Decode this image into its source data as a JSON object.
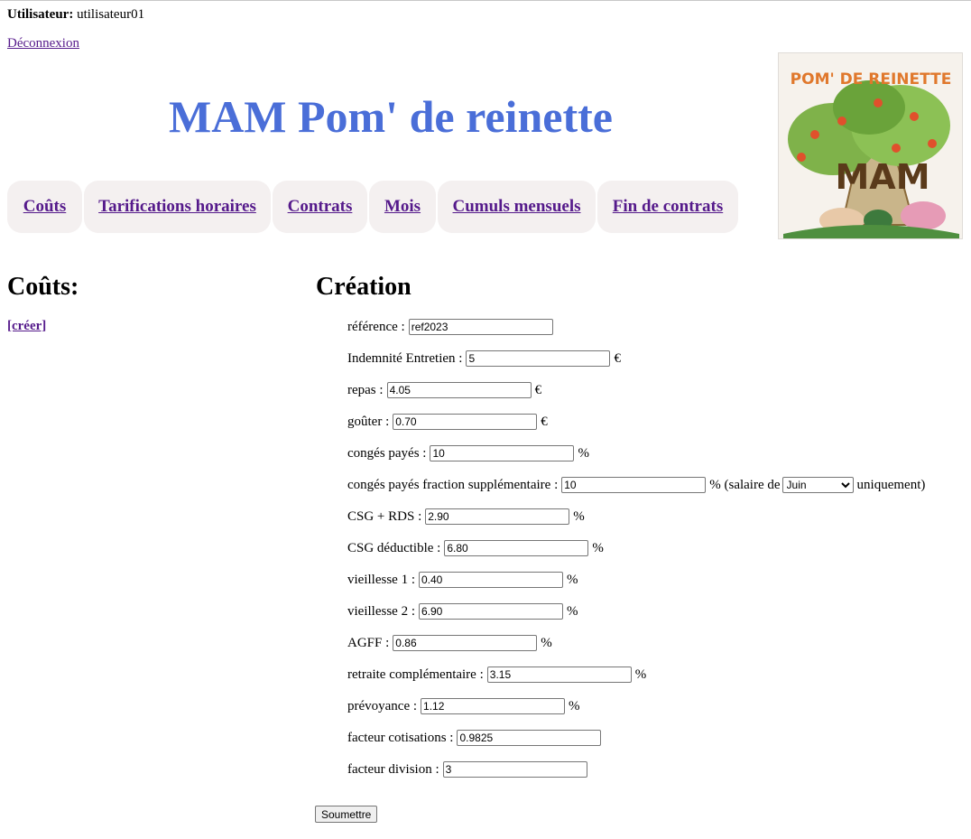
{
  "header": {
    "user_label": "Utilisateur:",
    "username": "utilisateur01",
    "logout_label": "Déconnexion",
    "site_title": "MAM Pom' de reinette",
    "logo_text": "POM' DE REINETTE",
    "logo_initials": "MAM"
  },
  "nav": {
    "items": [
      {
        "label": "Coûts"
      },
      {
        "label": "Tarifications horaires"
      },
      {
        "label": "Contrats"
      },
      {
        "label": "Mois"
      },
      {
        "label": "Cumuls mensuels"
      },
      {
        "label": "Fin de contrats"
      }
    ]
  },
  "sidebar": {
    "heading": "Coûts:",
    "create_link": "[créer]"
  },
  "form": {
    "heading": "Création",
    "submit_label": "Soumettre",
    "fields": [
      {
        "label": "référence :",
        "value": "ref2023",
        "unit": ""
      },
      {
        "label": "Indemnité Entretien :",
        "value": "5",
        "unit": "€"
      },
      {
        "label": "repas :",
        "value": "4.05",
        "unit": "€"
      },
      {
        "label": "goûter :",
        "value": "0.70",
        "unit": "€"
      },
      {
        "label": "congés payés :",
        "value": "10",
        "unit": "%"
      },
      {
        "label": "congés payés fraction supplémentaire :",
        "value": "10",
        "unit": "% (salaire de",
        "select_value": "Juin",
        "suffix": "uniquement)"
      },
      {
        "label": "CSG + RDS :",
        "value": "2.90",
        "unit": "%"
      },
      {
        "label": "CSG déductible :",
        "value": "6.80",
        "unit": "%"
      },
      {
        "label": "vieillesse 1 :",
        "value": "0.40",
        "unit": "%"
      },
      {
        "label": "vieillesse 2 :",
        "value": "6.90",
        "unit": "%"
      },
      {
        "label": "AGFF :",
        "value": "0.86",
        "unit": "%"
      },
      {
        "label": "retraite complémentaire :",
        "value": "3.15",
        "unit": "%"
      },
      {
        "label": "prévoyance :",
        "value": "1.12",
        "unit": "%"
      },
      {
        "label": "facteur cotisations :",
        "value": "0.9825",
        "unit": ""
      },
      {
        "label": "facteur division :",
        "value": "3",
        "unit": ""
      }
    ]
  },
  "colors": {
    "title": "#4a6ed8",
    "link": "#551a8b",
    "tab_bg": "#f4f0f0"
  }
}
